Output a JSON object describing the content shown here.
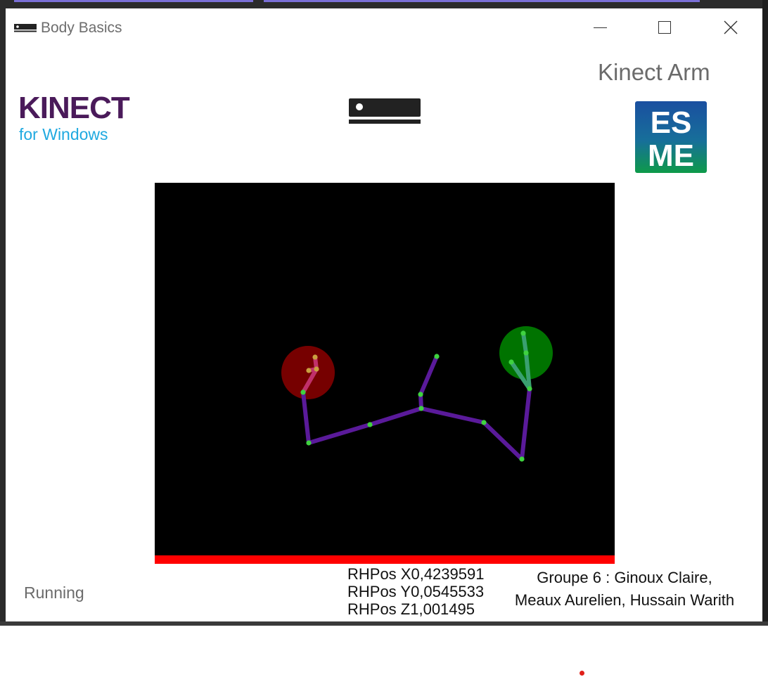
{
  "window": {
    "title": "Body Basics",
    "icon": "kinect-sensor-icon"
  },
  "header": {
    "kinect_logo_word": "KINECT",
    "kinect_logo_sub": "for Windows",
    "app_heading": "Kinect Arm",
    "esme_logo_top": "ES",
    "esme_logo_bottom": "ME"
  },
  "status": {
    "text": "Running"
  },
  "hand_readout": {
    "x": "RHPos X0,4239591",
    "y": "RHPos Y0,0545533",
    "z": "RHPos Z1,001495"
  },
  "credits": {
    "line1": "Groupe 6 : Ginoux Claire,",
    "line2": "Meaux Aurelien, Hussain Warith"
  },
  "colors": {
    "bone": "#5a1a9a",
    "joint": "#3fd23f",
    "left_hand_state": "#8b0000",
    "right_hand_state": "#008000",
    "tracking_bar": "#ff0000"
  }
}
